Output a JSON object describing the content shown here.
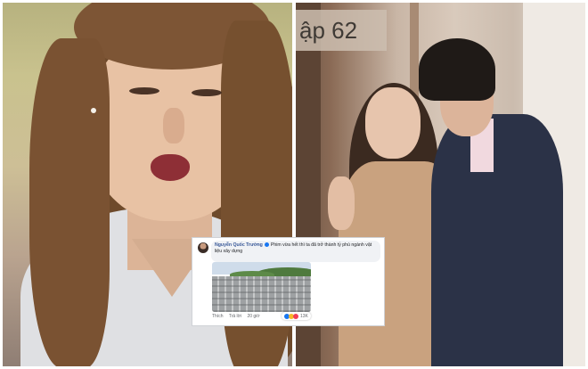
{
  "overlay": {
    "episode_label": "ập 62"
  },
  "comment": {
    "author": "Nguyễn Quốc Trường",
    "text": "Phim vừa hết thì ta đã trở thành tỷ phú ngành vật liệu xây dựng",
    "actions": {
      "like": "Thích",
      "reply": "Trả lời",
      "time": "20 giờ"
    },
    "reaction_count": "13K",
    "reaction_icons": [
      "like-icon",
      "haha-icon",
      "love-icon"
    ]
  }
}
